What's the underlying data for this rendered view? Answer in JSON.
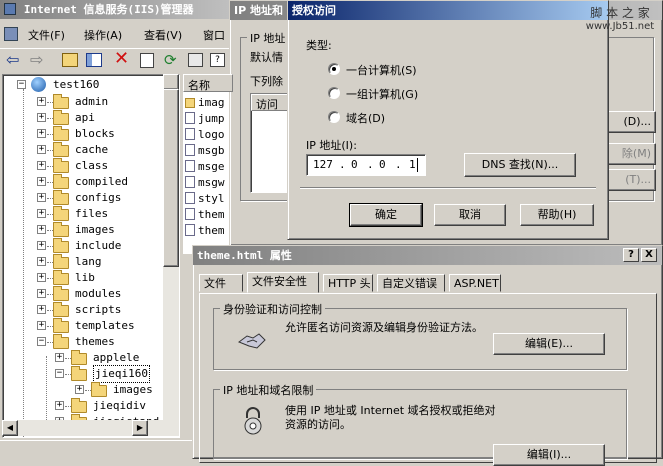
{
  "main_window": {
    "title": "Internet 信息服务(IIS)管理器",
    "menu": [
      "文件(F)",
      "操作(A)",
      "查看(V)",
      "窗口"
    ],
    "tree": {
      "root": "test160",
      "items": [
        "admin",
        "api",
        "blocks",
        "cache",
        "class",
        "compiled",
        "configs",
        "files",
        "images",
        "include",
        "lang",
        "lib",
        "modules",
        "scripts",
        "templates",
        "themes"
      ],
      "themes_children": [
        "applele",
        "jieqi160"
      ],
      "jieqi160_children": [
        "images"
      ],
      "after": [
        "jieqidiv",
        "jieqistand"
      ]
    },
    "list": {
      "header_name": "名称",
      "rows": [
        "imag",
        "jump",
        "logo",
        "msgb",
        "msge",
        "msgw",
        "styl",
        "them",
        "them"
      ]
    }
  },
  "ip_dialog": {
    "title": "IP 地址和",
    "group_title": "IP 地址",
    "default_label": "默认情",
    "list_label": "下列除",
    "access_header": "访问",
    "side_buttons": [
      "(D)...",
      "除(M)",
      "(T)..."
    ]
  },
  "grant_dialog": {
    "title": "授权访问",
    "type_label": "类型:",
    "options": [
      {
        "label": "一台计算机(S)",
        "checked": true
      },
      {
        "label": "一组计算机(G)",
        "checked": false
      },
      {
        "label": "域名(D)",
        "checked": false
      }
    ],
    "ip_label": "IP 地址(I):",
    "ip_parts": [
      "127",
      "0",
      "0",
      "1"
    ],
    "dns_button": "DNS 查找(N)...",
    "ok_button": "确定",
    "cancel_button": "取消",
    "help_button": "帮助(H)"
  },
  "watermark": {
    "line1": "脚 本 之 家",
    "line2": "www.Jb51.net"
  },
  "props_dialog": {
    "title": "theme.html 属性",
    "help_btn": "?",
    "close_btn": "X",
    "tabs": [
      "文件",
      "文件安全性",
      "HTTP 头",
      "自定义错误",
      "ASP.NET"
    ],
    "selected_tab": 1,
    "auth_group": {
      "title": "身份验证和访问控制",
      "text": "允许匿名访问资源及编辑身份验证方法。",
      "button": "编辑(E)..."
    },
    "ip_group": {
      "title": "IP 地址和域名限制",
      "text": "使用 IP 地址或 Internet 域名授权或拒绝对资源的访问。",
      "button": "编辑(I)..."
    }
  }
}
